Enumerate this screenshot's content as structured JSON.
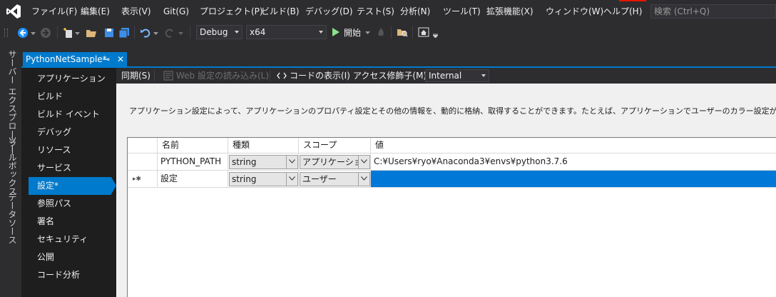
{
  "menu": {
    "items": [
      "ファイル(F)",
      "編集(E)",
      "表示(V)",
      "Git(G)",
      "プロジェクト(P)",
      "ビルド(B)",
      "デバッグ(D)",
      "テスト(S)",
      "分析(N)",
      "ツール(T)",
      "拡張機能(X)",
      "ウィンドウ(W)",
      "ヘルプ(H)"
    ],
    "search_placeholder": "検索 (Ctrl+Q)"
  },
  "toolbar": {
    "config": "Debug",
    "platform": "x64",
    "start_label": "開始"
  },
  "side_tabs": [
    "サーバー エクスプローラー",
    "ツールボックス",
    "データソース"
  ],
  "document_tab": {
    "title": "PythonNetSample*",
    "pin_glyph": "⊸",
    "close_glyph": "✕"
  },
  "nav": {
    "items": [
      "アプリケーション",
      "ビルド",
      "ビルド イベント",
      "デバッグ",
      "リソース",
      "サービス",
      "設定*",
      "参照パス",
      "署名",
      "セキュリティ",
      "公開",
      "コード分析"
    ],
    "selected_index": 6
  },
  "settings_toolbar": {
    "sync": "同期(S)",
    "load_web": "Web 設定の読み込み(L)",
    "view_code": "コードの表示(I)",
    "access_label": "アクセス修飾子(M):",
    "access_value": "Internal"
  },
  "description": "アプリケーション設定によって、アプリケーションのプロパティ設定とその他の情報を、動的に格納、取得することができます。たとえば、アプリケーションでユーザーのカラー設定が保存された後、次回",
  "grid": {
    "headers": [
      "名前",
      "種類",
      "スコープ",
      "値"
    ],
    "rows": [
      {
        "indicator": "",
        "name": "PYTHON_PATH",
        "type": "string",
        "scope": "アプリケーション",
        "value": "C:¥Users¥ryo¥Anaconda3¥envs¥python3.7.6"
      },
      {
        "indicator": "▸✱",
        "name": "設定",
        "type": "string",
        "scope": "ユーザー",
        "value": ""
      }
    ]
  },
  "colors": {
    "accent": "#007acc",
    "selection": "#0078d7",
    "chrome": "#2d2d30",
    "start_green": "#8ae28a"
  }
}
